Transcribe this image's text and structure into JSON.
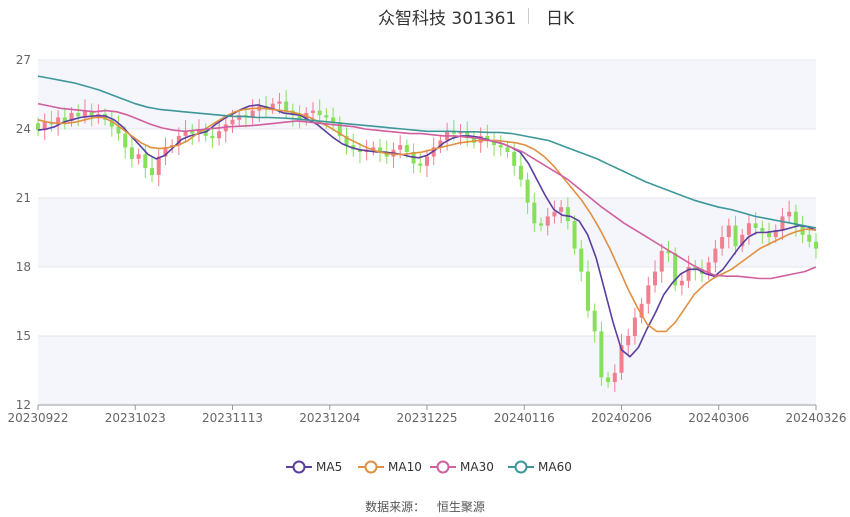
{
  "header": {
    "name_code": "众智科技 301361",
    "period": "日K"
  },
  "footer": {
    "source_label": "数据来源：",
    "source_value": "恒生聚源"
  },
  "colors": {
    "up": "#f07f8f",
    "down": "#86e05a",
    "grid": "#e4e7ee",
    "band": "#f4f6fb",
    "axis_text": "#666666"
  },
  "chart_data": {
    "type": "candlestick",
    "ylim": [
      12,
      27
    ],
    "yticks": [
      12,
      15,
      18,
      21,
      24,
      27
    ],
    "xtick_labels": [
      "20230922",
      "20231023",
      "20231113",
      "20231204",
      "20231225",
      "20240116",
      "20240206",
      "20240306",
      "20240326"
    ],
    "legend": [
      {
        "name": "MA5",
        "color": "#5b3ea0"
      },
      {
        "name": "MA10",
        "color": "#e09040"
      },
      {
        "name": "MA30",
        "color": "#d1609f"
      },
      {
        "name": "MA60",
        "color": "#3d979a"
      }
    ],
    "closes": [
      23.95,
      24.3,
      24.2,
      24.5,
      24.35,
      24.7,
      24.55,
      24.8,
      24.6,
      24.65,
      24.4,
      24.1,
      23.8,
      23.2,
      22.7,
      22.9,
      22.3,
      22.0,
      22.8,
      23.2,
      23.3,
      23.7,
      23.9,
      23.8,
      24.0,
      23.7,
      23.6,
      23.9,
      24.2,
      24.4,
      24.6,
      24.5,
      24.8,
      25.0,
      24.9,
      25.1,
      25.2,
      24.8,
      24.6,
      24.4,
      24.7,
      24.8,
      24.6,
      24.5,
      24.3,
      23.7,
      23.3,
      23.1,
      23.0,
      23.1,
      23.2,
      23.0,
      22.8,
      23.1,
      23.3,
      23.0,
      22.5,
      22.4,
      22.8,
      23.2,
      23.5,
      23.9,
      23.8,
      23.9,
      23.6,
      23.4,
      23.7,
      23.5,
      23.3,
      23.2,
      23.0,
      22.4,
      21.8,
      20.8,
      19.9,
      19.8,
      20.2,
      20.4,
      20.6,
      20.0,
      18.8,
      17.8,
      16.1,
      15.2,
      13.2,
      13.0,
      13.4,
      14.6,
      15.0,
      15.8,
      16.4,
      17.2,
      17.8,
      18.7,
      18.6,
      17.2,
      17.4,
      18.0,
      17.9,
      17.7,
      18.2,
      18.8,
      19.3,
      19.8,
      18.9,
      19.4,
      19.9,
      19.7,
      19.5,
      19.3,
      19.6,
      20.2,
      20.4,
      19.8,
      19.4,
      19.1,
      18.8
    ],
    "series": [
      {
        "name": "MA5",
        "values": [
          23.95,
          24.0,
          24.1,
          24.3,
          24.4,
          24.5,
          24.55,
          24.58,
          24.56,
          24.4,
          24.1,
          23.7,
          23.3,
          22.9,
          22.7,
          22.85,
          23.2,
          23.55,
          23.7,
          23.8,
          23.9,
          24.2,
          24.45,
          24.65,
          24.85,
          25.0,
          25.05,
          24.95,
          24.85,
          24.7,
          24.65,
          24.6,
          24.4,
          24.2,
          23.9,
          23.6,
          23.35,
          23.2,
          23.1,
          23.05,
          23.0,
          23.0,
          22.95,
          22.9,
          22.8,
          22.75,
          22.85,
          23.1,
          23.4,
          23.6,
          23.7,
          23.7,
          23.65,
          23.55,
          23.45,
          23.35,
          23.2,
          23.0,
          22.5,
          21.8,
          21.1,
          20.5,
          20.25,
          20.2,
          20.0,
          19.4,
          18.4,
          17.0,
          15.6,
          14.4,
          14.1,
          14.5,
          15.3,
          16.0,
          16.8,
          17.3,
          17.7,
          17.9,
          17.9,
          17.7,
          17.6,
          17.9,
          18.4,
          18.9,
          19.3,
          19.5,
          19.5,
          19.55,
          19.6,
          19.7,
          19.8,
          19.75,
          19.6
        ]
      },
      {
        "name": "MA10",
        "values": [
          24.4,
          24.3,
          24.25,
          24.25,
          24.3,
          24.4,
          24.5,
          24.5,
          24.3,
          24.0,
          23.7,
          23.4,
          23.2,
          23.15,
          23.2,
          23.3,
          23.5,
          23.8,
          24.05,
          24.3,
          24.55,
          24.75,
          24.85,
          24.9,
          24.9,
          24.85,
          24.8,
          24.75,
          24.65,
          24.5,
          24.3,
          24.1,
          23.85,
          23.6,
          23.4,
          23.2,
          23.05,
          22.95,
          22.9,
          22.9,
          22.95,
          23.0,
          23.1,
          23.2,
          23.3,
          23.4,
          23.45,
          23.5,
          23.5,
          23.5,
          23.45,
          23.4,
          23.3,
          23.1,
          22.8,
          22.4,
          21.9,
          21.4,
          20.9,
          20.3,
          19.6,
          18.8,
          17.9,
          17.0,
          16.2,
          15.5,
          15.2,
          15.2,
          15.6,
          16.2,
          16.8,
          17.2,
          17.5,
          17.7,
          17.9,
          18.2,
          18.5,
          18.8,
          19.0,
          19.2,
          19.4,
          19.55,
          19.65,
          19.6
        ]
      },
      {
        "name": "MA30",
        "values": [
          25.1,
          25.0,
          24.9,
          24.85,
          24.8,
          24.75,
          24.8,
          24.75,
          24.6,
          24.4,
          24.2,
          24.05,
          23.95,
          23.9,
          23.95,
          24.0,
          24.05,
          24.1,
          24.12,
          24.15,
          24.2,
          24.25,
          24.3,
          24.35,
          24.3,
          24.25,
          24.2,
          24.15,
          24.1,
          24.0,
          23.95,
          23.9,
          23.85,
          23.8,
          23.8,
          23.75,
          23.7,
          23.7,
          23.65,
          23.6,
          23.5,
          23.4,
          23.2,
          23.0,
          22.7,
          22.4,
          22.1,
          21.8,
          21.4,
          21.0,
          20.6,
          20.25,
          19.9,
          19.6,
          19.3,
          19.0,
          18.7,
          18.4,
          18.1,
          17.85,
          17.65,
          17.6,
          17.6,
          17.55,
          17.5,
          17.5,
          17.6,
          17.7,
          17.8,
          18.0
        ]
      },
      {
        "name": "MA60",
        "values": [
          26.3,
          26.2,
          26.1,
          26.0,
          25.85,
          25.7,
          25.5,
          25.3,
          25.1,
          24.95,
          24.85,
          24.8,
          24.75,
          24.7,
          24.65,
          24.6,
          24.55,
          24.55,
          24.5,
          24.5,
          24.48,
          24.45,
          24.4,
          24.35,
          24.3,
          24.25,
          24.2,
          24.15,
          24.1,
          24.05,
          24.0,
          23.95,
          23.9,
          23.9,
          23.9,
          23.88,
          23.88,
          23.85,
          23.85,
          23.8,
          23.7,
          23.6,
          23.5,
          23.3,
          23.1,
          22.9,
          22.7,
          22.45,
          22.2,
          21.95,
          21.7,
          21.5,
          21.3,
          21.1,
          20.9,
          20.75,
          20.6,
          20.5,
          20.35,
          20.2,
          20.1,
          20.0,
          19.9,
          19.8,
          19.7
        ]
      }
    ]
  }
}
